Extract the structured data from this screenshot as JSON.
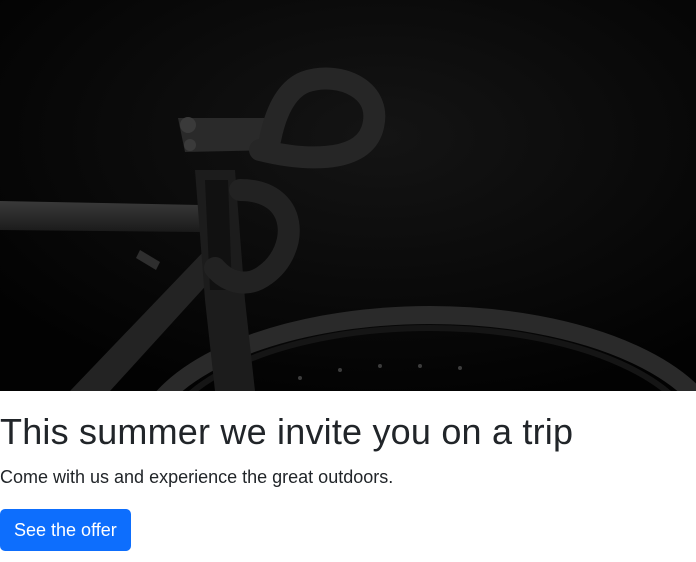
{
  "hero": {
    "image_subject": "black road bicycle handlebar and wheel on dark background"
  },
  "card": {
    "title": "This summer we invite you on a trip",
    "subtitle": "Come with us and experience the great outdoors.",
    "cta_label": "See the offer"
  },
  "colors": {
    "accent": "#0d6efd",
    "hero_bg": "#050505",
    "text": "#212529"
  }
}
